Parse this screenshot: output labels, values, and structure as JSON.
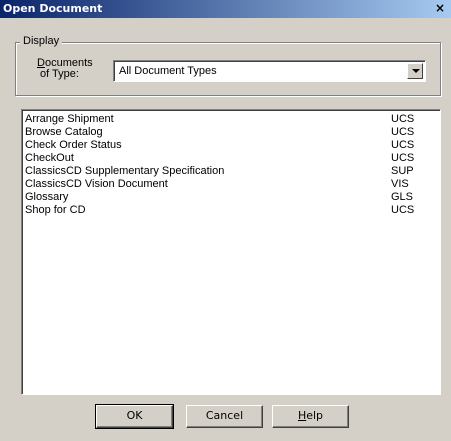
{
  "window": {
    "title": "Open Document",
    "close_glyph": "×"
  },
  "display_group": {
    "legend": "Display",
    "doctype_label_line1_rest": "ocuments",
    "doctype_label_line1_mnemonic": "D",
    "doctype_label_line2": "of Type:",
    "selected_type": "All Document Types"
  },
  "documents": [
    {
      "name": "Arrange Shipment",
      "type": "UCS"
    },
    {
      "name": "Browse Catalog",
      "type": "UCS"
    },
    {
      "name": "Check Order Status",
      "type": "UCS"
    },
    {
      "name": "CheckOut",
      "type": "UCS"
    },
    {
      "name": "ClassicsCD Supplementary Specification",
      "type": "SUP"
    },
    {
      "name": "ClassicsCD Vision Document",
      "type": "VIS"
    },
    {
      "name": "Glossary",
      "type": "GLS"
    },
    {
      "name": "Shop for CD",
      "type": "UCS"
    }
  ],
  "buttons": {
    "ok": "OK",
    "cancel": "Cancel",
    "help_mnemonic": "H",
    "help_rest": "elp"
  }
}
